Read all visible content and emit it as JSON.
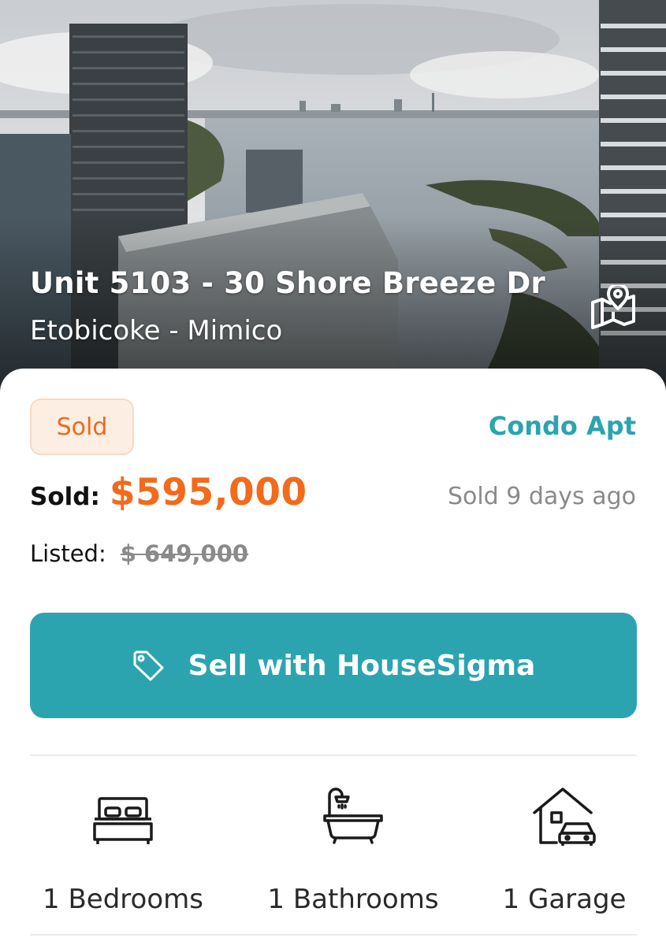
{
  "hero": {
    "title": "Unit 5103 - 30 Shore Breeze Dr",
    "subtitle": "Etobicoke - Mimico",
    "map_icon": "map-pin-icon"
  },
  "listing": {
    "status_badge": "Sold",
    "property_type": "Condo Apt",
    "sold_label": "Sold:",
    "sold_price": "$595,000",
    "sold_ago": "Sold 9 days ago",
    "listed_label": "Listed:",
    "listed_price": "$ 649,000"
  },
  "cta": {
    "label": "Sell with HouseSigma",
    "icon": "tag-icon"
  },
  "features": [
    {
      "icon": "bed-icon",
      "label": "1 Bedrooms"
    },
    {
      "icon": "bathtub-icon",
      "label": "1 Bathrooms"
    },
    {
      "icon": "garage-icon",
      "label": "1 Garage"
    }
  ],
  "colors": {
    "accent_teal": "#2ba4b0",
    "price_orange": "#f26a1b",
    "badge_bg": "#fdeee3",
    "muted_text": "#8a8a8a"
  }
}
